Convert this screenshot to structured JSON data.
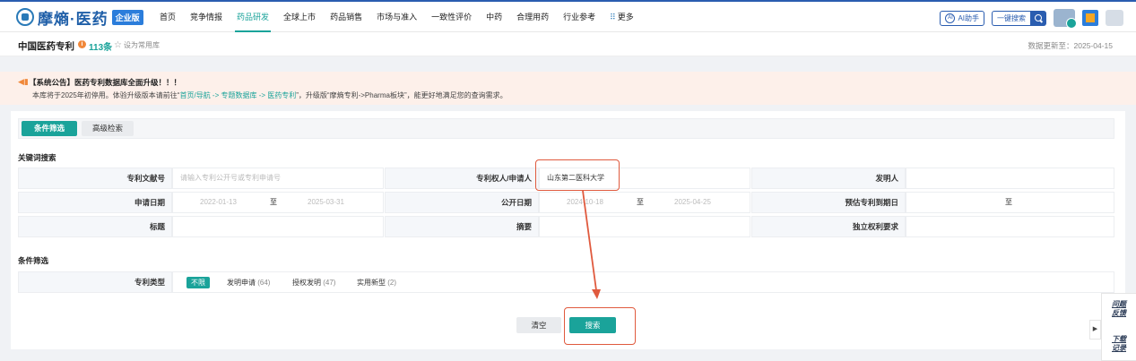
{
  "header": {
    "logo_text": "摩熵·医药",
    "logo_badge": "企业版",
    "nav": [
      {
        "label": "首页",
        "active": false
      },
      {
        "label": "竞争情报",
        "active": false
      },
      {
        "label": "药品研发",
        "active": true
      },
      {
        "label": "全球上市",
        "active": false
      },
      {
        "label": "药品销售",
        "active": false
      },
      {
        "label": "市场与准入",
        "active": false
      },
      {
        "label": "一致性评价",
        "active": false
      },
      {
        "label": "中药",
        "active": false
      },
      {
        "label": "合理用药",
        "active": false
      },
      {
        "label": "行业参考",
        "active": false
      },
      {
        "label": "更多",
        "active": false
      }
    ],
    "ai_label": "AI助手",
    "ai_mark": "AI",
    "quick_search_label": "一键搜索"
  },
  "titlebar": {
    "title": "中国医药专利",
    "info_mark": "i",
    "count": "113条",
    "favorite_label": "设为常用库",
    "update_label": "数据更新至：2025-04-15"
  },
  "notice": {
    "title": "【系统公告】医药专利数据库全面升级！！！",
    "body_prefix": "本库将于2025年初停用。体验升级版本请前往“",
    "body_link": "首页/导航 -> 专题数据库 -> 医药专利",
    "body_suffix": "”，升级版“摩熵专利->Pharma板块”，能更好地满足您的查询需求。"
  },
  "tabs": {
    "filter": "条件筛选",
    "advanced": "高级检索"
  },
  "keyword_section": {
    "title": "关键词搜索",
    "patent_no_label": "专利文献号",
    "patent_no_placeholder": "请输入专利公开号或专利申请号",
    "holder_label": "专利权人/申请人",
    "holder_value": "山东第二医科大学",
    "inventor_label": "发明人",
    "apply_date_label": "申请日期",
    "apply_date_start": "2022-01-13",
    "apply_date_end": "2025-03-31",
    "publish_date_label": "公开日期",
    "publish_date_start": "2024-10-18",
    "publish_date_end": "2025-04-25",
    "expiry_label": "预估专利到期日",
    "to": "至",
    "title_label": "标题",
    "abstract_label": "摘要",
    "independent_claim_label": "独立权利要求"
  },
  "condition_section": {
    "title": "条件筛选",
    "type_label": "专利类型",
    "options": [
      {
        "label": "不限",
        "count": "",
        "selected": true
      },
      {
        "label": "发明申请",
        "count": "(64)",
        "selected": false
      },
      {
        "label": "授权发明",
        "count": "(47)",
        "selected": false
      },
      {
        "label": "实用新型",
        "count": "(2)",
        "selected": false
      }
    ]
  },
  "actions": {
    "clear": "清空",
    "search": "搜索"
  },
  "side": {
    "feedback": "问题反馈",
    "download": "下载记录",
    "toggle": "▶"
  },
  "colors": {
    "accent": "#1aa39a",
    "brand": "#2a5db0",
    "annotation": "#e05a3e"
  }
}
